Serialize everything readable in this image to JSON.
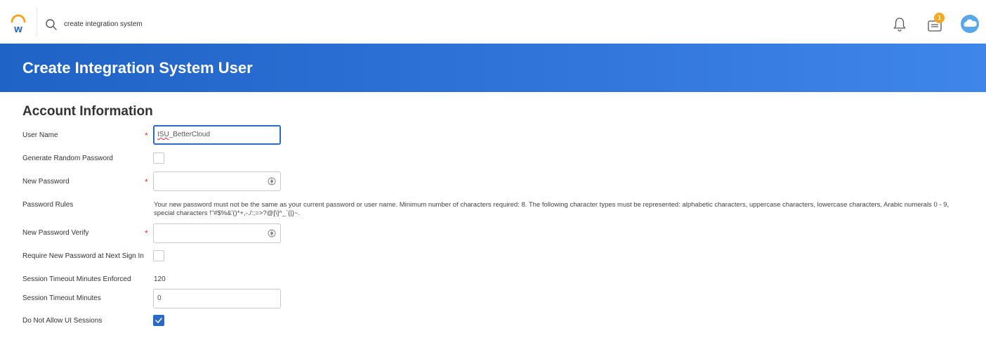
{
  "topbar": {
    "search_text": "create integration system",
    "notification_badge": "1",
    "icons": [
      "workday-logo-icon",
      "search-icon",
      "bell-icon",
      "inbox-icon",
      "avatar-cloud-icon"
    ]
  },
  "banner": {
    "title": "Create Integration System User",
    "color": "#2f72d8"
  },
  "section": {
    "title": "Account Information"
  },
  "fields": {
    "user_name": {
      "label": "User Name",
      "value_prefix": "ISU",
      "value_suffix": "_BetterCloud",
      "required": true
    },
    "generate_random_password": {
      "label": "Generate Random Password",
      "checked": false
    },
    "new_password": {
      "label": "New Password",
      "value": "",
      "required": true
    },
    "password_rules": {
      "label": "Password Rules",
      "text": "Your new password must not be the same as your current password or user name. Minimum number of characters required: 8. The following character types must be represented: alphabetic characters, uppercase characters, lowercase characters, Arabic numerals 0 - 9, special characters !\"#$%&'()*+,-./:;=>?@[\\]^_`{|}~."
    },
    "new_password_verify": {
      "label": "New Password Verify",
      "value": "",
      "required": true
    },
    "require_new_password": {
      "label": "Require New Password at Next Sign In",
      "checked": false
    },
    "session_timeout_enforced": {
      "label": "Session Timeout Minutes Enforced",
      "value": "120"
    },
    "session_timeout_minutes": {
      "label": "Session Timeout Minutes",
      "value": "0"
    },
    "do_not_allow_ui": {
      "label": "Do Not Allow UI Sessions",
      "checked": true
    }
  },
  "required_marker": "*"
}
